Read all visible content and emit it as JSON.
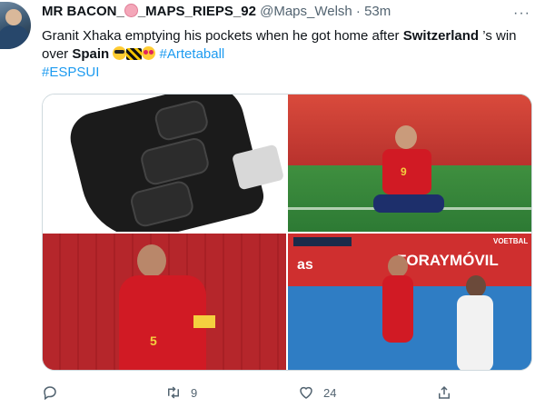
{
  "tweet": {
    "display_name": "MR BACON_",
    "display_name_suffix": "_MAPS_RIEPS_92",
    "handle": "@Maps_Welsh",
    "separator": "·",
    "time": "53m",
    "more_label": "···",
    "text": {
      "part1": "Granit Xhaka emptying his pockets when he got home after ",
      "bold1": "Switzerland",
      "part2": " ’s win over ",
      "bold2": "Spain",
      "hashtag1": "#Artetaball",
      "hashtag2": "#ESPSUI"
    },
    "images": [
      {
        "icon": "car-key-photo"
      },
      {
        "icon": "player-sitting-photo",
        "jersey_number": "9"
      },
      {
        "icon": "player-standing-photo",
        "jersey_number": "5"
      },
      {
        "icon": "player-broadcast-photo",
        "banner_text": "FORAYMÓVIL",
        "banner_left": "as",
        "watermark": "VOETBAL"
      }
    ],
    "actions": {
      "reply_count": "",
      "retweet_count": "9",
      "like_count": "24",
      "share_count": ""
    }
  },
  "colors": {
    "hashtag": "#1d9bf0",
    "secondary_text": "#536471",
    "spain_red": "#d11a24"
  }
}
